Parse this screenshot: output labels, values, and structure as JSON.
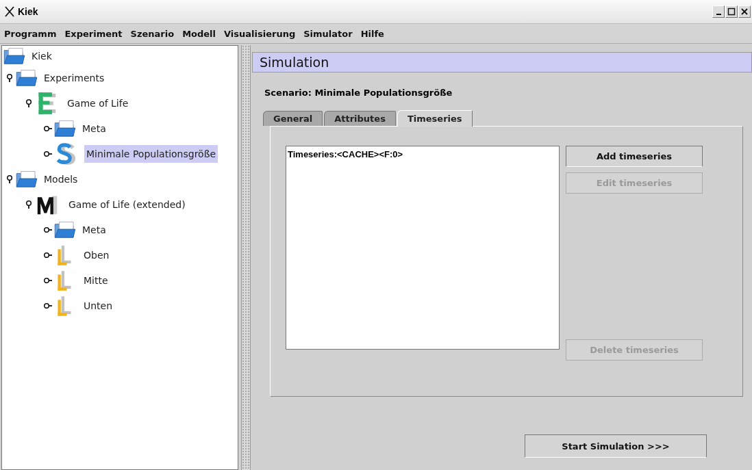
{
  "window": {
    "title": "Kiek"
  },
  "menu": [
    "Programm",
    "Experiment",
    "Szenario",
    "Modell",
    "Visualisierung",
    "Simulator",
    "Hilfe"
  ],
  "tree": [
    {
      "label": "Kiek",
      "kind": "folder",
      "selected": false,
      "children": [
        {
          "label": "Experiments",
          "kind": "folder",
          "expanded": true,
          "selected": false,
          "children": [
            {
              "label": "Game of Life",
              "kind": "experiment",
              "expanded": true,
              "selected": false,
              "children": [
                {
                  "label": "Meta",
                  "kind": "folder",
                  "expanded": false,
                  "selected": false
                },
                {
                  "label": "Minimale Populationsgröße",
                  "kind": "scenario",
                  "expanded": false,
                  "selected": true
                }
              ]
            }
          ]
        },
        {
          "label": "Models",
          "kind": "folder",
          "expanded": true,
          "selected": false,
          "children": [
            {
              "label": "Game of Life (extended)",
              "kind": "model",
              "expanded": true,
              "selected": false,
              "children": [
                {
                  "label": "Meta",
                  "kind": "folder",
                  "expanded": false,
                  "selected": false
                },
                {
                  "label": "Oben",
                  "kind": "layer",
                  "expanded": false,
                  "selected": false
                },
                {
                  "label": "Mitte",
                  "kind": "layer",
                  "expanded": false,
                  "selected": false
                },
                {
                  "label": "Unten",
                  "kind": "layer",
                  "expanded": false,
                  "selected": false
                }
              ]
            }
          ]
        }
      ]
    }
  ],
  "panel": {
    "title": "Simulation",
    "scenario": "Scenario: Minimale Populationsgröße",
    "tabs": [
      {
        "label": "General",
        "selected": false
      },
      {
        "label": "Attributes",
        "selected": false
      },
      {
        "label": "Timeseries",
        "selected": true
      }
    ],
    "list_items": [
      "Timeseries:<CACHE><F:0>"
    ],
    "buttons": [
      {
        "label": "Add timeseries",
        "disabled": false
      },
      {
        "label": "Edit timeseries",
        "disabled": true
      },
      {
        "label": "Delete timeseries",
        "disabled": true
      }
    ],
    "start_button": "Start Simulation >>>"
  }
}
